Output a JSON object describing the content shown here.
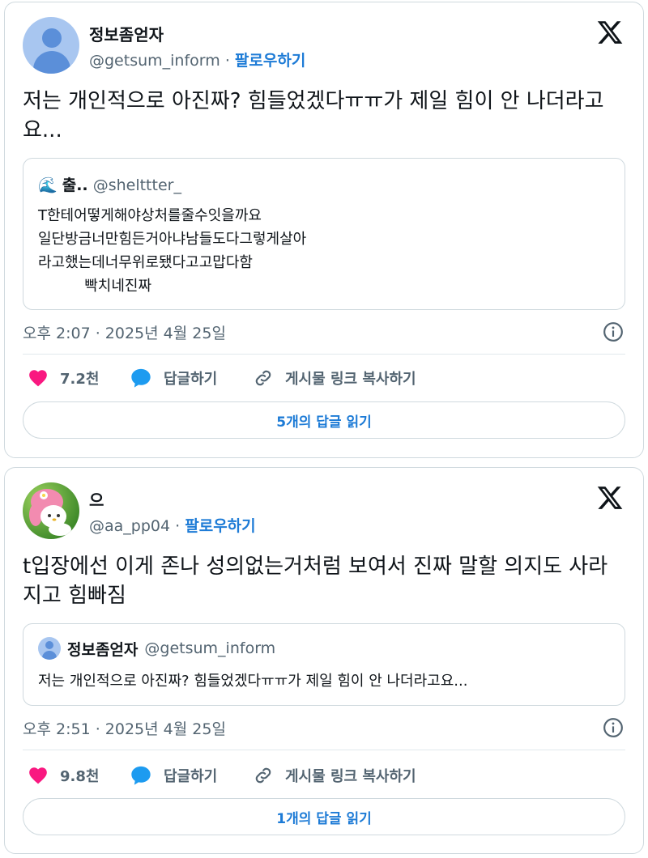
{
  "tweets": [
    {
      "author": {
        "name": "정보좀얻자",
        "handle": "@getsum_inform",
        "follow_label": "팔로우하기"
      },
      "text": "저는 개인적으로 아진짜? 힘들었겠다ㅠㅠ가 제일 힘이 안 나더라고요...",
      "quote": {
        "emoji": "🌊",
        "name": "출..",
        "handle": "@shelttter_",
        "text": "T한테어떻게해야상처를줄수잇을까요\n일단방금너만힘든거아냐남들도다그렇게살아\n라고했는데너무위로됐다고고맙다함\n          빡치네진짜"
      },
      "timestamp": "오후 2:07 · 2025년 4월 25일",
      "likes": "7.2천",
      "reply_label": "답글하기",
      "copy_label": "게시물 링크 복사하기",
      "read_replies_label": "5개의 답글 읽기"
    },
    {
      "author": {
        "name": "으",
        "handle": "@aa_pp04",
        "follow_label": "팔로우하기"
      },
      "text": "t입장에선 이게 존나 성의없는거처럼 보여서 진짜 말할 의지도 사라지고 힘빠짐",
      "quote": {
        "name": "정보좀얻자",
        "handle": "@getsum_inform",
        "text": "저는 개인적으로 아진짜? 힘들었겠다ㅠㅠ가 제일 힘이 안 나더라고요..."
      },
      "timestamp": "오후 2:51 · 2025년 4월 25일",
      "likes": "9.8천",
      "reply_label": "답글하기",
      "copy_label": "게시물 링크 복사하기",
      "read_replies_label": "1개의 답글 읽기"
    }
  ],
  "icons": {
    "like": "heart-icon",
    "reply": "speech-bubble-icon",
    "copy": "link-icon",
    "info": "info-icon",
    "brand": "x-logo-icon"
  },
  "colors": {
    "like": "#f91880",
    "reply": "#1d9bf0",
    "link": "#1d7bd6",
    "muted": "#536471"
  }
}
